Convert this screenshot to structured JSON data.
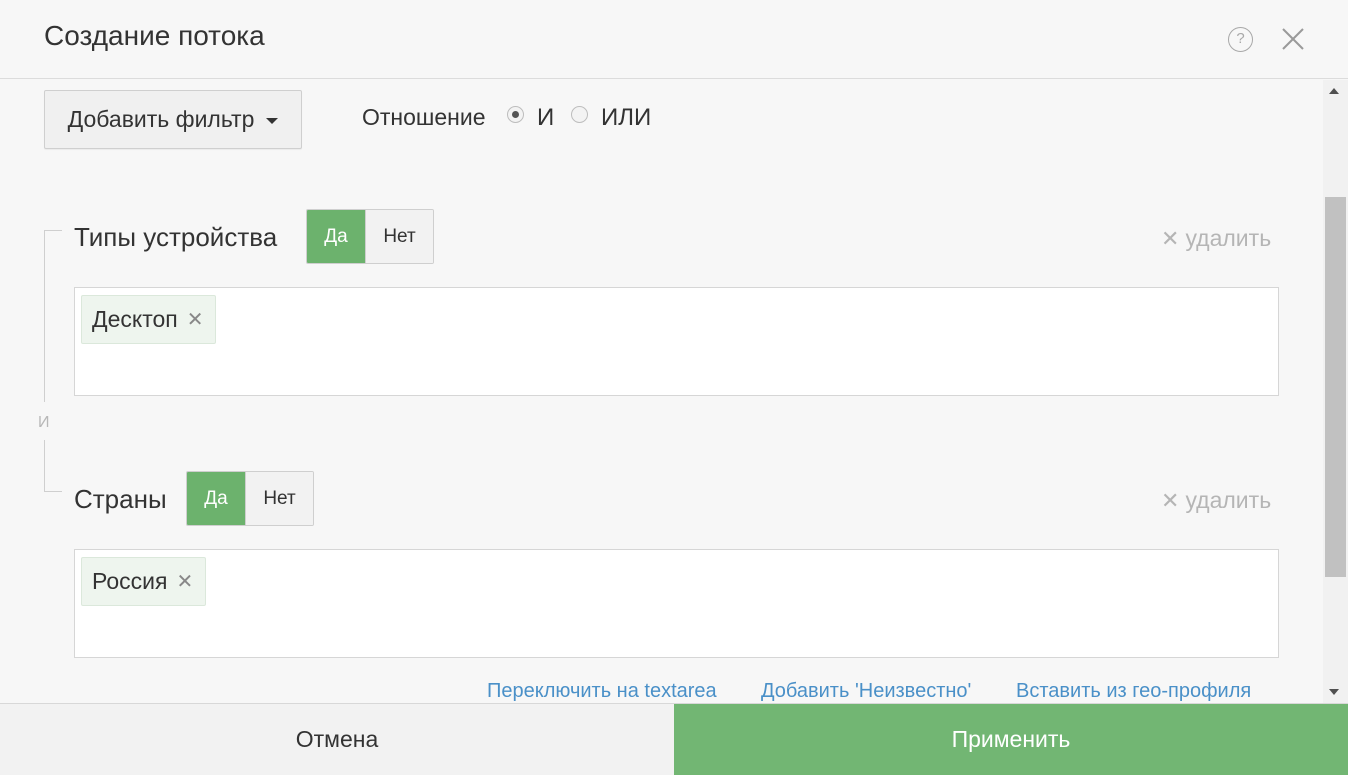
{
  "dialog": {
    "title": "Создание потока",
    "help_glyph": "?",
    "close_icon": "close-icon"
  },
  "toolbar": {
    "add_filter_label": "Добавить фильтр",
    "relation_label": "Отношение",
    "relation_options": [
      {
        "label": "И",
        "selected": true
      },
      {
        "label": "ИЛИ",
        "selected": false
      }
    ]
  },
  "connector": {
    "label": "И"
  },
  "filters": [
    {
      "label": "Типы устройства",
      "toggle_yes": "Да",
      "toggle_no": "Нет",
      "active": "Да",
      "remove_label": "удалить",
      "remove_glyph": "✕",
      "chips": [
        {
          "label": "Десктоп",
          "remove_glyph": "✕"
        }
      ]
    },
    {
      "label": "Страны",
      "toggle_yes": "Да",
      "toggle_no": "Нет",
      "active": "Да",
      "remove_label": "удалить",
      "remove_glyph": "✕",
      "chips": [
        {
          "label": "Россия",
          "remove_glyph": "✕"
        }
      ]
    }
  ],
  "links": {
    "switch_textarea": "Переключить на textarea",
    "add_unknown": "Добавить 'Неизвестно'",
    "insert_geo": "Вставить из гео-профиля"
  },
  "footer": {
    "cancel_label": "Отмена",
    "apply_label": "Применить"
  },
  "colors": {
    "accent_green": "#72b673",
    "toggle_green": "#6cb26d",
    "link_blue": "#4a90c8"
  }
}
